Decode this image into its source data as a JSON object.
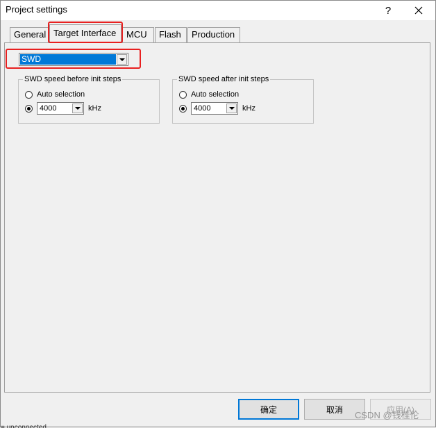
{
  "window": {
    "title": "Project settings",
    "help_glyph": "?"
  },
  "tabs": [
    {
      "label": "General"
    },
    {
      "label": "Target Interface"
    },
    {
      "label": "MCU"
    },
    {
      "label": "Flash"
    },
    {
      "label": "Production"
    }
  ],
  "interface_select": {
    "value": "SWD"
  },
  "groups": {
    "before": {
      "title": "SWD speed before init steps",
      "auto_label": "Auto selection",
      "speed_value": "4000",
      "unit": "kHz",
      "selected": "manual"
    },
    "after": {
      "title": "SWD speed after init steps",
      "auto_label": "Auto selection",
      "speed_value": "4000",
      "unit": "kHz",
      "selected": "manual"
    }
  },
  "buttons": {
    "ok": "确定",
    "cancel": "取消",
    "apply": "应用(A)"
  },
  "watermark": "CSDN @钱桂伦",
  "bleed_text": "= unconnected",
  "colors": {
    "accent": "#0078d7",
    "highlight_frame": "#e82020"
  }
}
